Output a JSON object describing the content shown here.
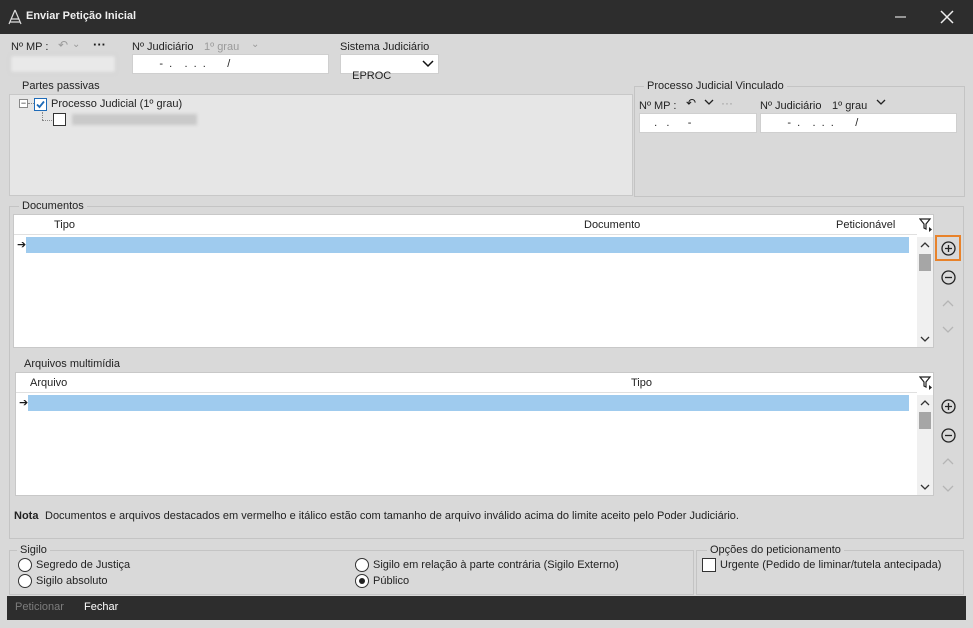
{
  "window": {
    "title": "Enviar Petição Inicial"
  },
  "header": {
    "nmp_label": "Nº MP :",
    "njud_label": "Nº Judiciário",
    "njud_grau": "1º grau",
    "njud_value": "       -  .    .  .  .       /",
    "sistema_label": "Sistema Judiciário",
    "sistema_value": "EPROC"
  },
  "partes": {
    "title": "Partes passivas",
    "tree_root": "Processo Judicial (1º grau)"
  },
  "vinculado": {
    "title": "Processo Judicial Vinculado",
    "nmp_label": "Nº MP :",
    "njud_label": "Nº Judiciário",
    "njud_grau": "1º grau",
    "nmp_value": "   .   .      -",
    "njud_value": "       -  .    .  .  .       /"
  },
  "documentos": {
    "title": "Documentos",
    "columns": [
      "Tipo",
      "Documento",
      "Peticionável"
    ]
  },
  "arquivos": {
    "title": "Arquivos multimídia",
    "columns": [
      "Arquivo",
      "Tipo"
    ]
  },
  "nota": {
    "label": "Nota",
    "text": "Documentos e arquivos destacados em vermelho e itálico estão com tamanho de arquivo inválido acima do limite aceito pelo Poder Judiciário."
  },
  "sigilo": {
    "title": "Sigilo",
    "options": [
      "Segredo de Justiça",
      "Sigilo absoluto",
      "Sigilo em relação à parte contrária (Sigilo Externo)",
      "Público"
    ],
    "selected": "Público"
  },
  "opcoes": {
    "title": "Opções do peticionamento",
    "urgente": "Urgente (Pedido de liminar/tutela antecipada)"
  },
  "footer": {
    "peticionar": "Peticionar",
    "fechar": "Fechar"
  },
  "colors": {
    "accent": "#e8822a",
    "selection": "#9fcbee",
    "titlebar": "#2d2d2d"
  }
}
